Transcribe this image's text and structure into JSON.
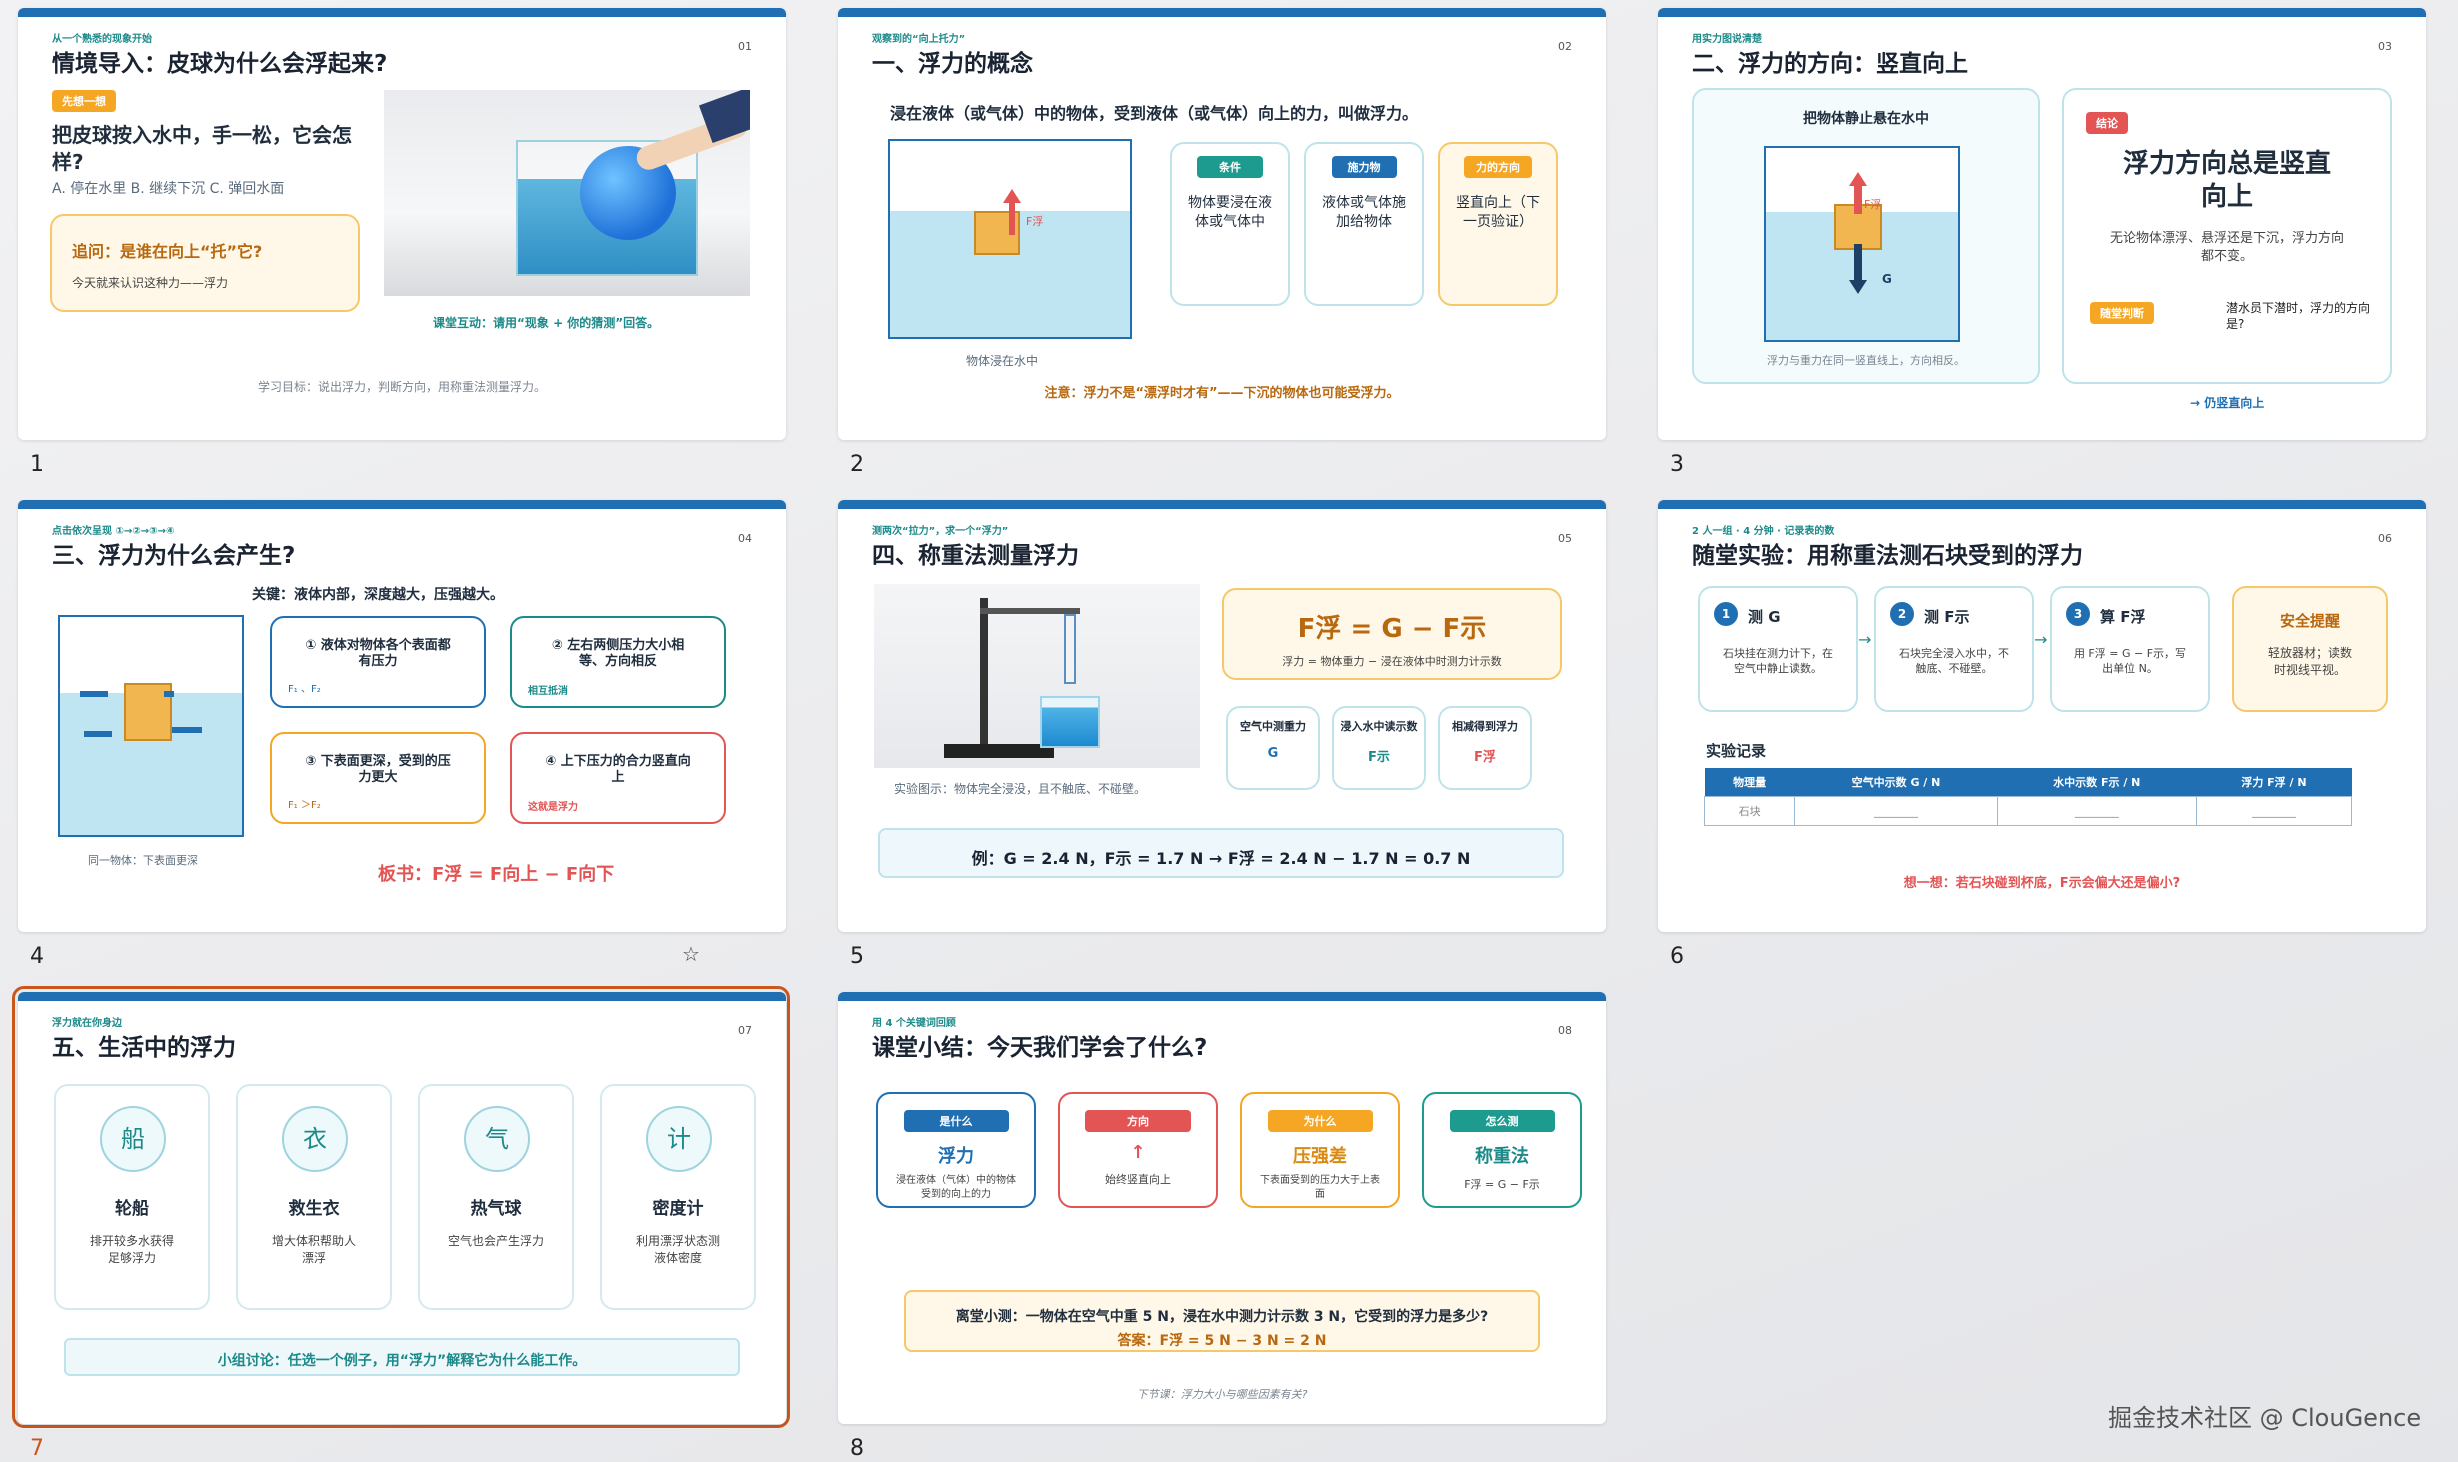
{
  "colors": {
    "accent": "#1f6fb2",
    "teal": "#1d8a8a",
    "red": "#e35454",
    "orange": "#f5a623",
    "selected": "#c9571c"
  },
  "slides": [
    {
      "number": "1",
      "eyebrow": "从一个熟悉的现象开始",
      "page": "01",
      "title": "情境导入：皮球为什么会浮起来?",
      "tag": "先想一想",
      "question": "把皮球按入水中，手一松，它会怎样?",
      "options": "A. 停在水里   B. 继续下沉   C. 弹回水面",
      "followup_title": "追问：是谁在向上“托”它?",
      "followup_sub": "今天就来认识这种力——浮力",
      "interaction": "课堂互动：请用“现象 + 你的猜测”回答。",
      "goal": "学习目标：说出浮力，判断方向，用称重法测量浮力。"
    },
    {
      "number": "2",
      "eyebrow": "观察到的“向上托力”",
      "page": "02",
      "title": "一、浮力的概念",
      "definition": "浸在液体（或气体）中的物体，受到液体（或气体）向上的力，叫做浮力。",
      "label_f": "F浮",
      "caption": "物体浸在水中",
      "cards": [
        {
          "tag": "条件",
          "text": "物体要浸在液体或气体中"
        },
        {
          "tag": "施力物",
          "text": "液体或气体施加给物体"
        },
        {
          "tag": "力的方向",
          "text": "竖直向上（下一页验证）"
        }
      ],
      "note": "注意：浮力不是“漂浮时才有”——下沉的物体也可能受浮力。"
    },
    {
      "number": "3",
      "eyebrow": "用实力图说清楚",
      "page": "03",
      "title": "二、浮力的方向：竖直向上",
      "left_title": "把物体静止悬在水中",
      "label_f": "F浮",
      "label_g": "G",
      "left_caption": "浮力与重力在同一竖直线上，方向相反。",
      "right_tag": "结论",
      "conclusion": "浮力方向总是竖直向上",
      "conclusion_sub": "无论物体漂浮、悬浮还是下沉，浮力方向都不变。",
      "quick_tag": "随堂判断",
      "quick_text": "潜水员下潜时，浮力的方向是?",
      "answer": "→ 仍竖直向上"
    },
    {
      "number": "4",
      "eyebrow": "点击依次呈现 ①→②→③→④",
      "page": "04",
      "title": "三、浮力为什么会产生?",
      "key": "关键：液体内部，深度越大，压强越大。",
      "cards": [
        {
          "head": "① 液体对物体各个表面都有压力",
          "sub": "F₁ 、F₂"
        },
        {
          "head": "② 左右两侧压力大小相等、方向相反",
          "sub": "相互抵消"
        },
        {
          "head": "③ 下表面更深，受到的压力更大",
          "sub": "F₁ ＞F₂"
        },
        {
          "head": "④ 上下压力的合力竖直向上",
          "sub": "这就是浮力"
        }
      ],
      "caption": "同一物体：下表面更深",
      "board": "板书：F浮 = F向上 − F向下"
    },
    {
      "number": "5",
      "eyebrow": "测两次“拉力”，求一个“浮力”",
      "page": "05",
      "title": "四、称重法测量浮力",
      "formula": "F浮 = G − F示",
      "formula_sub": "浮力 = 物体重力 − 浸在液体中时测力计示数",
      "steps": [
        {
          "head": "空气中测重力",
          "val": "G"
        },
        {
          "head": "浸入水中读示数",
          "val": "F示"
        },
        {
          "head": "相减得到浮力",
          "val": "F浮"
        }
      ],
      "photo_caption": "实验图示：物体完全浸没，且不触底、不碰壁。",
      "example": "例：G = 2.4 N，F示 = 1.7 N  →  F浮 = 2.4 N − 1.7 N = 0.7 N"
    },
    {
      "number": "6",
      "eyebrow": "2 人一组 · 4 分钟 · 记录表的数",
      "page": "06",
      "title": "随堂实验：用称重法测石块受到的浮力",
      "steps": [
        {
          "n": "1",
          "head": "测 G",
          "text": "石块挂在测力计下，在空气中静止读数。"
        },
        {
          "n": "2",
          "head": "测 F示",
          "text": "石块完全浸入水中，不触底、不碰壁。"
        },
        {
          "n": "3",
          "head": "算 F浮",
          "text": "用 F浮 = G − F示，写出单位 N。"
        }
      ],
      "safety_title": "安全提醒",
      "safety_text": "轻放器材；读数时视线平视。",
      "record_title": "实验记录",
      "table_headers": [
        "物理量",
        "空气中示数 G / N",
        "水中示数 F示 / N",
        "浮力 F浮 / N"
      ],
      "table_row": [
        "石块",
        "________",
        "________",
        "________"
      ],
      "think": "想一想：若石块碰到杯底，F示会偏大还是偏小?"
    },
    {
      "number": "7",
      "eyebrow": "浮力就在你身边",
      "page": "07",
      "title": "五、生活中的浮力",
      "cards": [
        {
          "icon": "船",
          "name": "轮船",
          "text": "排开较多水获得足够浮力"
        },
        {
          "icon": "衣",
          "name": "救生衣",
          "text": "增大体积帮助人漂浮"
        },
        {
          "icon": "气",
          "name": "热气球",
          "text": "空气也会产生浮力"
        },
        {
          "icon": "计",
          "name": "密度计",
          "text": "利用漂浮状态测液体密度"
        }
      ],
      "discussion": "小组讨论：任选一个例子，用“浮力”解释它为什么能工作。"
    },
    {
      "number": "8",
      "eyebrow": "用 4 个关键词回顾",
      "page": "08",
      "title": "课堂小结：今天我们学会了什么?",
      "cards": [
        {
          "tag": "是什么",
          "main": "浮力",
          "text": "浸在液体（气体）中的物体受到的向上的力"
        },
        {
          "tag": "方向",
          "main": "↑",
          "text": "始终竖直向上"
        },
        {
          "tag": "为什么",
          "main": "压强差",
          "text": "下表面受到的压力大于上表面"
        },
        {
          "tag": "怎么测",
          "main": "称重法",
          "text": "F浮 = G − F示"
        }
      ],
      "quiz": "离堂小测：一物体在空气中重 5 N，浸在水中测力计示数 3 N，它受到的浮力是多少?",
      "answer": "答案：F浮 = 5 N − 3 N = 2 N",
      "next": "下节课：浮力大小与哪些因素有关?"
    }
  ],
  "watermark": "掘金技术社区 @ ClouGence"
}
